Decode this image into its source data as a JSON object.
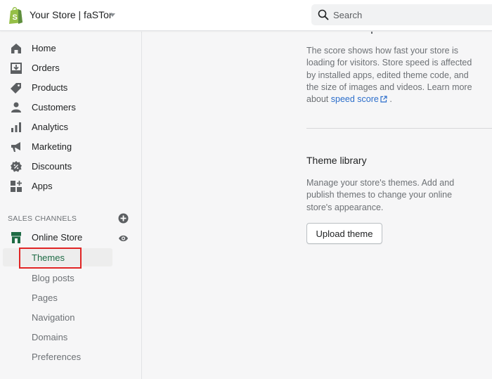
{
  "topbar": {
    "store_name": "Your Store | faSTor",
    "search_placeholder": "Search"
  },
  "sidebar": {
    "items": [
      {
        "label": "Home",
        "icon": "home-icon"
      },
      {
        "label": "Orders",
        "icon": "orders-icon"
      },
      {
        "label": "Products",
        "icon": "tag-icon"
      },
      {
        "label": "Customers",
        "icon": "person-icon"
      },
      {
        "label": "Analytics",
        "icon": "bar-chart-icon"
      },
      {
        "label": "Marketing",
        "icon": "megaphone-icon"
      },
      {
        "label": "Discounts",
        "icon": "discount-badge-icon"
      },
      {
        "label": "Apps",
        "icon": "apps-grid-icon"
      }
    ],
    "sales_channels_title": "SALES CHANNELS",
    "online_store": {
      "label": "Online Store",
      "icon": "storefront-icon"
    },
    "sub_items": [
      {
        "label": "Themes",
        "active": true
      },
      {
        "label": "Blog posts"
      },
      {
        "label": "Pages"
      },
      {
        "label": "Navigation"
      },
      {
        "label": "Domains"
      },
      {
        "label": "Preferences"
      }
    ]
  },
  "main": {
    "speed": {
      "text_1": "The score shows how fast your store is",
      "text_2": "loading for visitors. Store speed is affected",
      "text_3": "by installed apps, edited theme code, and",
      "text_4": "the size of images and videos. Learn more",
      "text_5_prefix": "about ",
      "link": "speed score",
      "text_5_suffix": " ."
    },
    "theme_library": {
      "title": "Theme library",
      "text_1": "Manage your store's themes. Add and",
      "text_2": "publish themes to change your online",
      "text_3": "store's appearance.",
      "upload_button": "Upload theme"
    }
  },
  "colors": {
    "accent_green": "#1e6b45",
    "link_blue": "#2c6ecb",
    "highlight_red": "#e02424",
    "shopify_green": "#95bf47"
  }
}
